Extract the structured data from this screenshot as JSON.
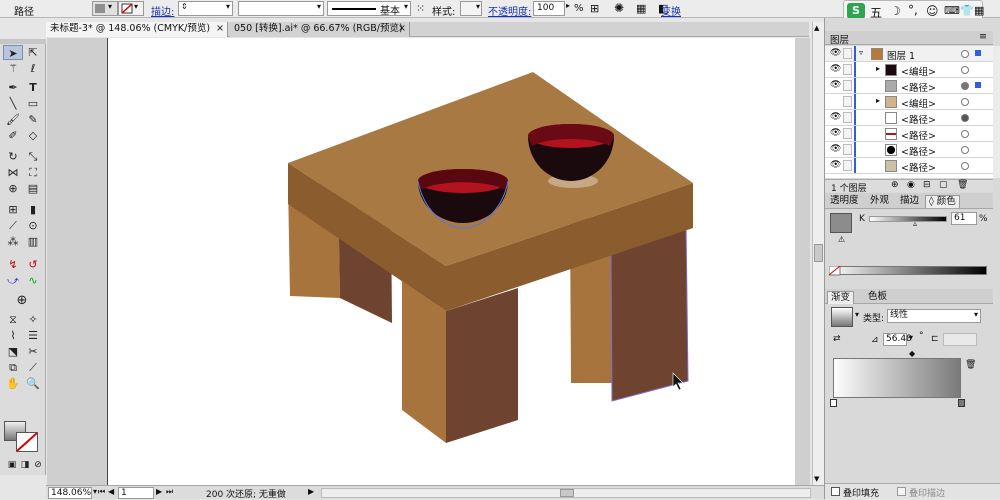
{
  "control_bar": {
    "object_type": "路径",
    "stroke_label": "描边:",
    "stroke_style": "基本",
    "style_label": "样式:",
    "opacity_label": "不透明度:",
    "opacity_value": "100",
    "opacity_unit": "%",
    "transform_label": "变换"
  },
  "ime_bar": {
    "brand": "S",
    "mode": "五"
  },
  "tabs": [
    {
      "label": "未标题-3* @ 148.06% (CMYK/预览)",
      "close": "×"
    },
    {
      "label": "050 [转换].ai* @ 66.67% (RGB/预览)",
      "close": "×"
    }
  ],
  "status_bar": {
    "zoom": "148.06%",
    "artboard_num": "1",
    "history": "200 次还原; 无重做"
  },
  "layers_panel": {
    "title": "图层",
    "rows": [
      {
        "name": "图层 1",
        "kind": "layer"
      },
      {
        "name": "<编组>",
        "kind": "group"
      },
      {
        "name": "<路径>",
        "kind": "path"
      },
      {
        "name": "<编组>",
        "kind": "group"
      },
      {
        "name": "<路径>",
        "kind": "path"
      },
      {
        "name": "<路径>",
        "kind": "path"
      },
      {
        "name": "<路径>",
        "kind": "path"
      },
      {
        "name": "<路径>",
        "kind": "path"
      }
    ],
    "footer": "1 个图层"
  },
  "color_panel": {
    "tabs": [
      "透明度",
      "外观",
      "描边",
      "颜色"
    ],
    "channel": "K",
    "value": "61",
    "unit": "%"
  },
  "gradient_panel": {
    "tabs": [
      "渐变",
      "色板"
    ],
    "type_label": "类型:",
    "type_value": "线性",
    "angle_value": "56.48",
    "angle_unit": "°"
  },
  "bottom_options": {
    "overprint_fill": "叠印填充",
    "overprint_stroke": "叠印描边"
  },
  "watermark": "jingyan.baidu.com",
  "colors": {
    "table_top": "#a87943",
    "table_front": "#8a5c2e",
    "leg_light": "#a8743e",
    "leg_dark": "#6e4430",
    "bowl_red": "#b3131f",
    "bowl_dark": "#1a0a0e"
  }
}
